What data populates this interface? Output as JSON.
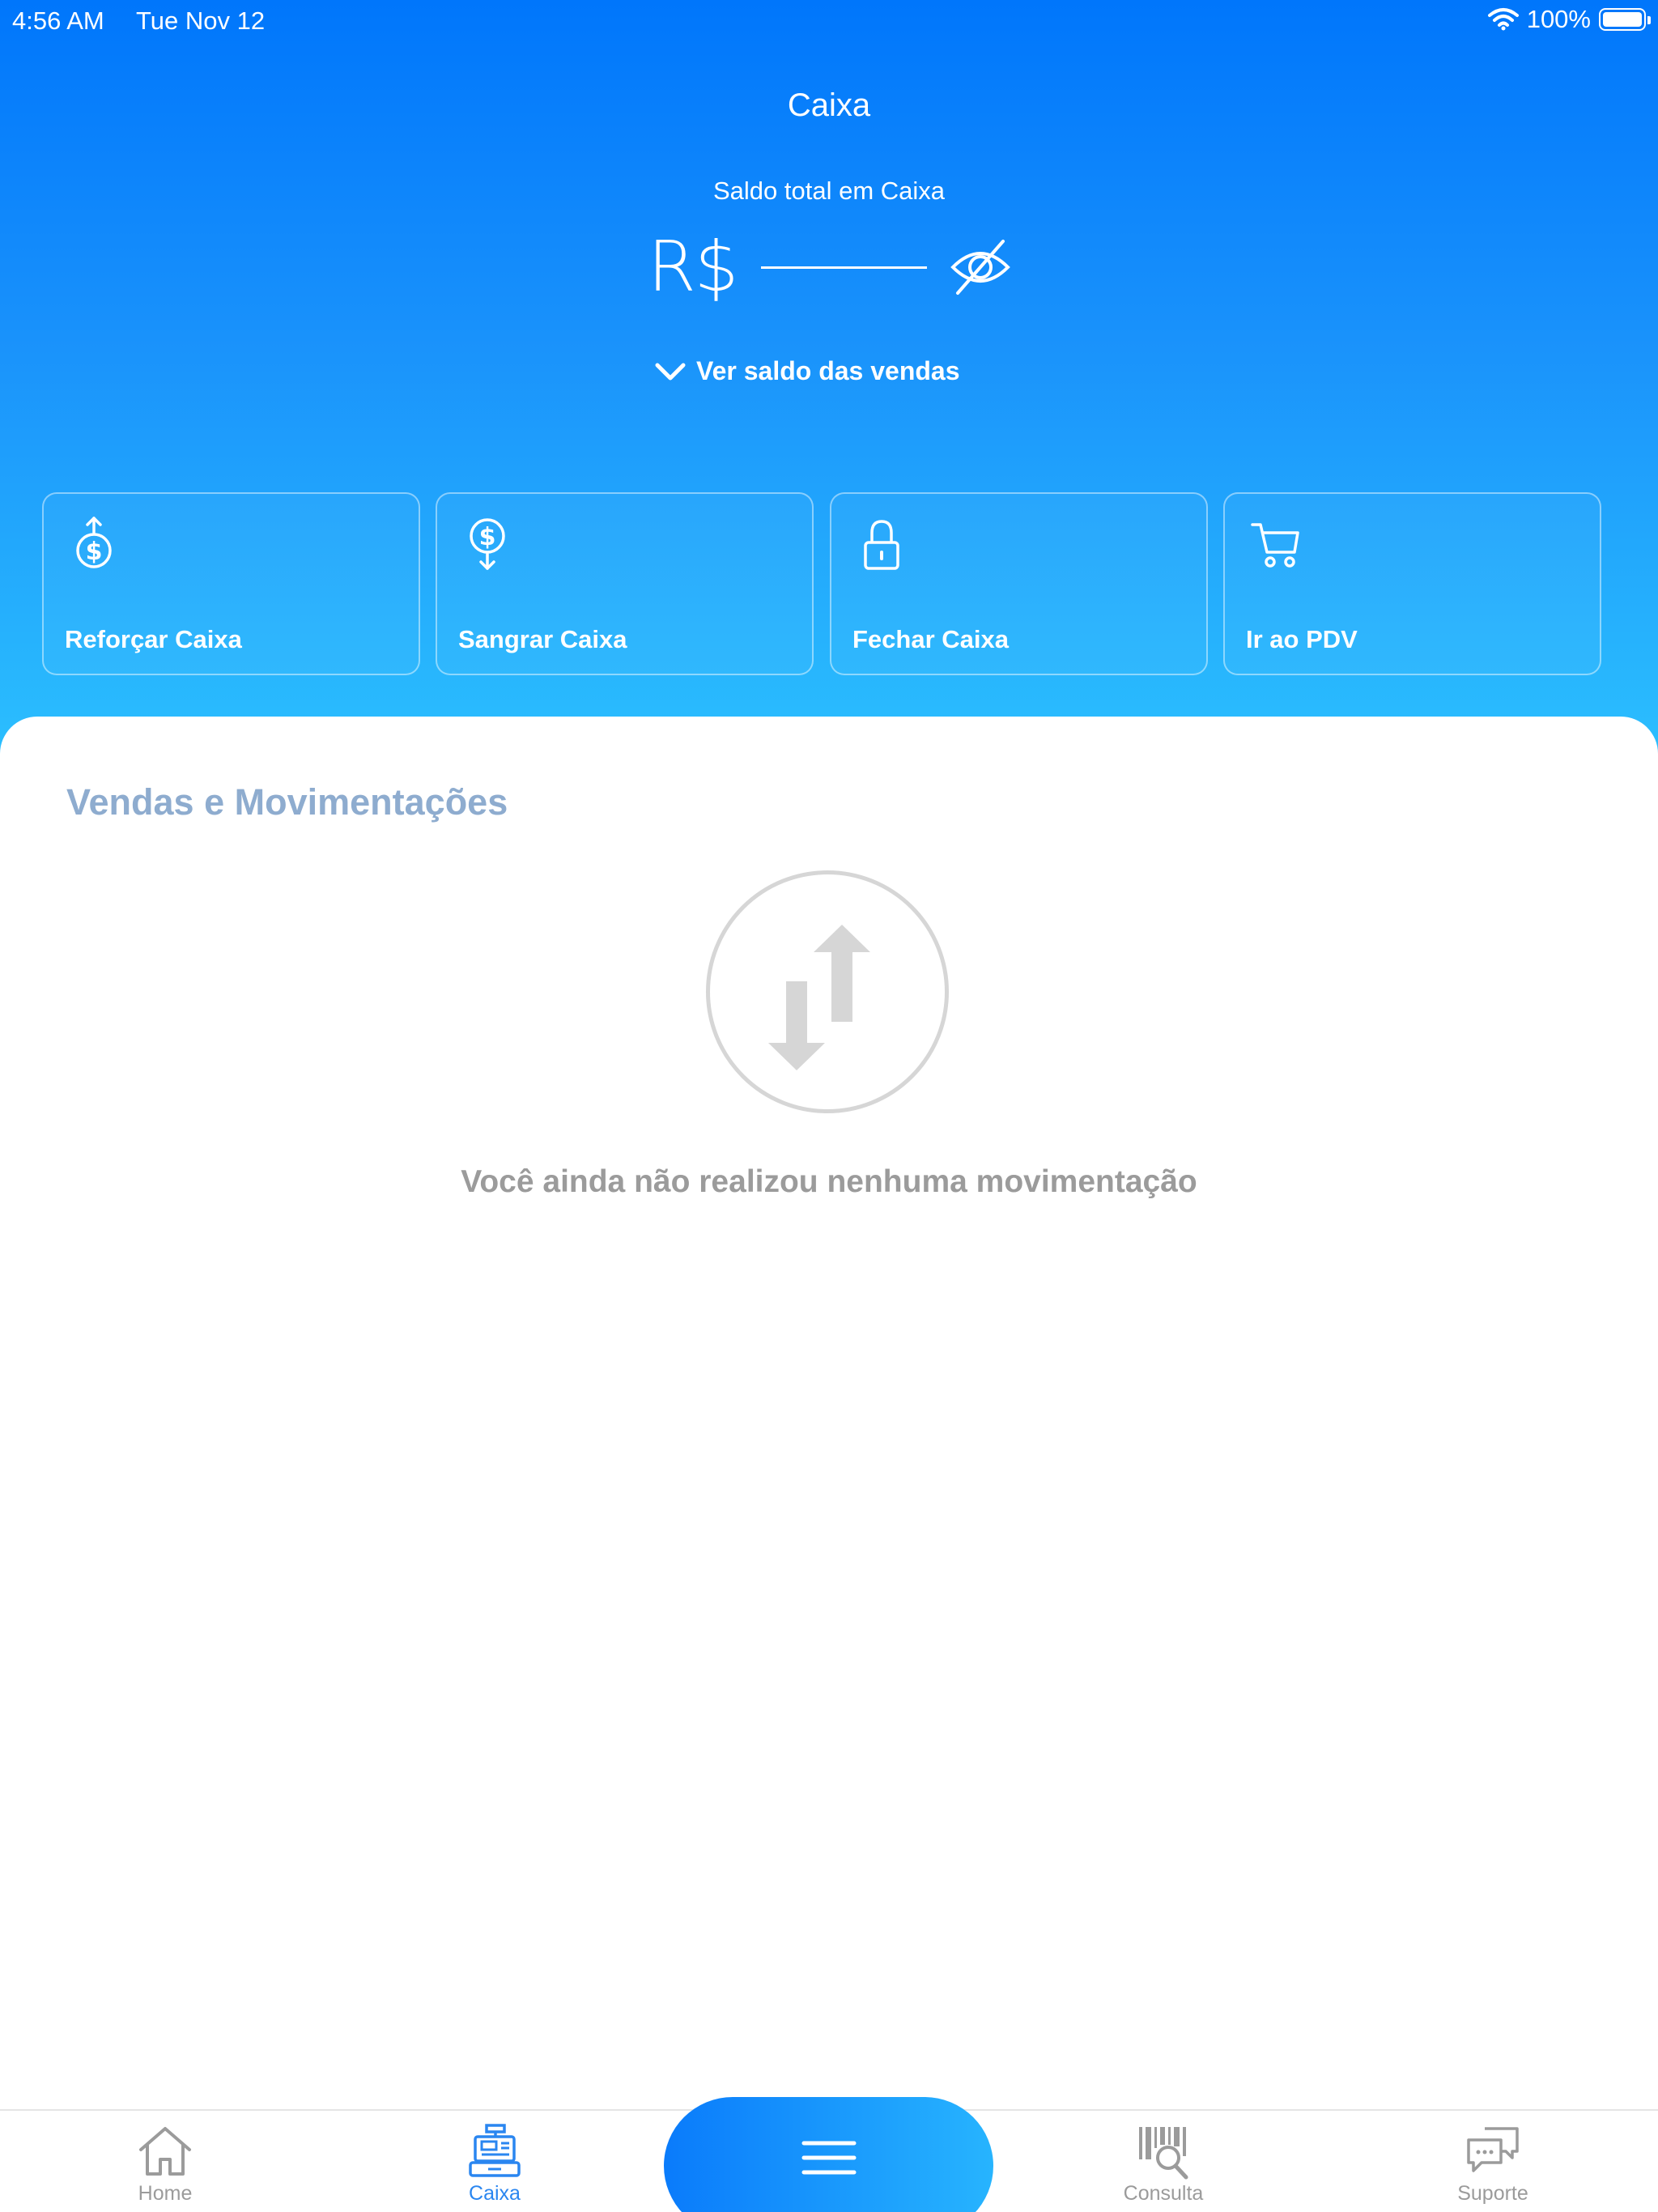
{
  "status_bar": {
    "time": "4:56 AM",
    "date": "Tue Nov 12",
    "battery": "100%",
    "wifi_icon": "wifi-icon",
    "battery_icon": "battery-icon"
  },
  "header": {
    "title": "Caixa",
    "balance_label": "Saldo total em Caixa",
    "currency": "R$",
    "visibility_icon": "eye-slash-icon",
    "toggle_sales_label": "Ver saldo das vendas",
    "toggle_icon": "chevron-down-icon"
  },
  "actions": [
    {
      "label": "Reforçar Caixa",
      "icon": "money-in-icon"
    },
    {
      "label": "Sangrar Caixa",
      "icon": "money-out-icon"
    },
    {
      "label": "Fechar Caixa",
      "icon": "lock-icon"
    },
    {
      "label": "Ir ao PDV",
      "icon": "cart-icon"
    }
  ],
  "movements": {
    "title": "Vendas e Movimentações",
    "empty_icon": "transfer-arrows-icon",
    "empty_message": "Você ainda não realizou nenhuma movimentação"
  },
  "tabbar": {
    "tabs": [
      {
        "label": "Home",
        "icon": "home-icon",
        "active": false
      },
      {
        "label": "Caixa",
        "icon": "cash-register-icon",
        "active": true
      },
      {
        "label": "Consulta",
        "icon": "barcode-search-icon",
        "active": false
      },
      {
        "label": "Suporte",
        "icon": "chat-bubbles-icon",
        "active": false
      }
    ],
    "menu_icon": "menu-icon"
  },
  "colors": {
    "header_gradient_top": "#0076fb",
    "header_gradient_bottom": "#2cc1fe",
    "section_title": "#8eaccf",
    "empty_state_gray": "#d6d6d6",
    "active_tab": "#2a86f0",
    "inactive_tab": "#9b9b9b"
  }
}
